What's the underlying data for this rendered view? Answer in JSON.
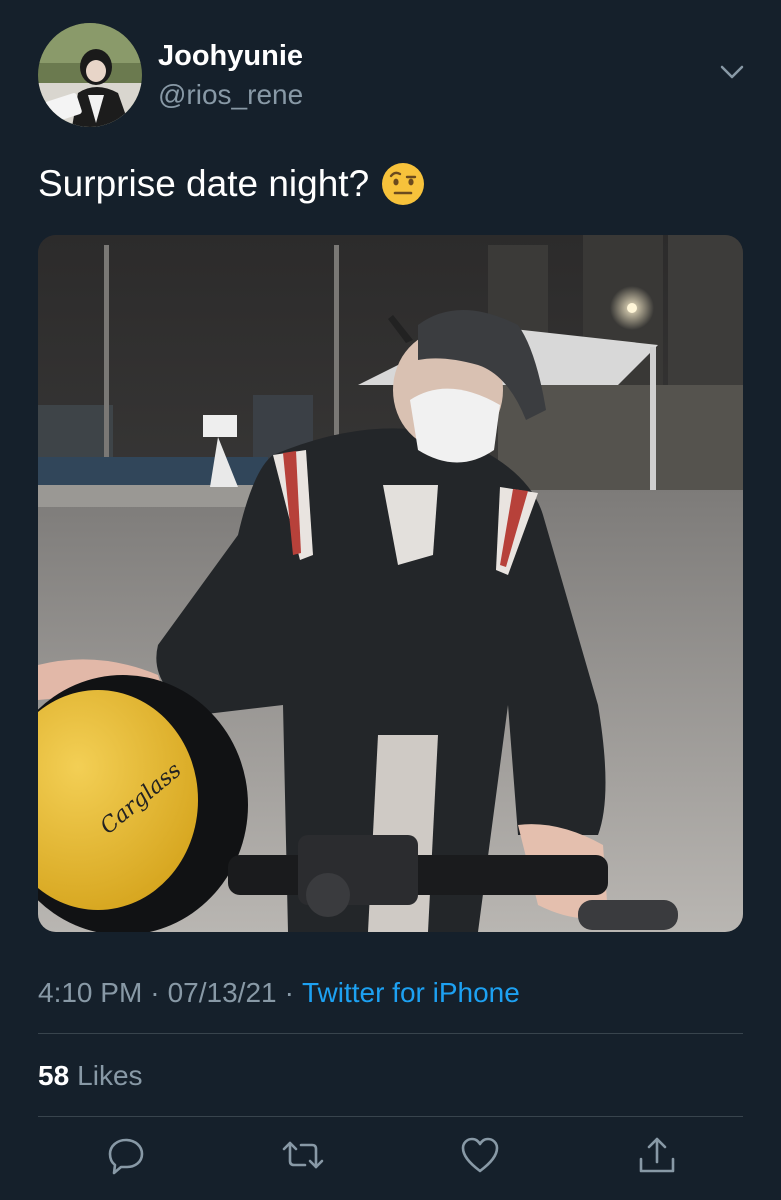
{
  "user": {
    "display_name": "Joohyunie",
    "handle": "@rios_rene",
    "avatar": "profile-photo"
  },
  "tweet": {
    "text": "Surprise date night?",
    "emoji": "face-with-raised-eyebrow"
  },
  "photo": {
    "helmet_text": "Carglass"
  },
  "meta": {
    "time": "4:10 PM",
    "separator": "·",
    "date": "07/13/21",
    "source": "Twitter for iPhone"
  },
  "stats": {
    "likes_count": "58",
    "likes_label": "Likes"
  },
  "actions": {
    "icons": [
      "reply-icon",
      "retweet-icon",
      "like-icon",
      "share-icon"
    ]
  },
  "colors": {
    "background": "#15202b",
    "secondary_text": "#8899a6",
    "link": "#1da1f2",
    "divider": "#38444d"
  }
}
